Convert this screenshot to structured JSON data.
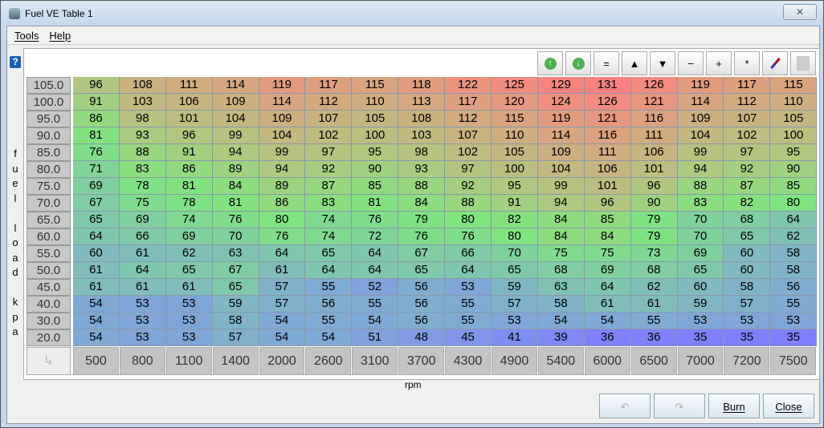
{
  "window": {
    "title": "Fuel VE Table 1",
    "close": "✕"
  },
  "menu": [
    "Tools",
    "Help"
  ],
  "help_icon": "?",
  "y_axis_label": "fuel load kpa",
  "x_axis_label": "rpm",
  "toolbar": [
    "up-circle",
    "down-circle",
    "=",
    "▲",
    "▼",
    "−",
    "+",
    "*",
    "pen",
    "square"
  ],
  "buttons": {
    "burn": "Burn",
    "close": "Close"
  },
  "table": {
    "y": [
      "105.0",
      "100.0",
      "95.0",
      "90.0",
      "85.0",
      "80.0",
      "75.0",
      "70.0",
      "65.0",
      "60.0",
      "55.0",
      "50.0",
      "45.0",
      "40.0",
      "30.0",
      "20.0"
    ],
    "x": [
      "500",
      "800",
      "1100",
      "1400",
      "2000",
      "2600",
      "3100",
      "3700",
      "4300",
      "4900",
      "5400",
      "6000",
      "6500",
      "7000",
      "7200",
      "7500"
    ],
    "values": [
      [
        96,
        108,
        111,
        114,
        119,
        117,
        115,
        118,
        122,
        125,
        129,
        131,
        126,
        119,
        117,
        115
      ],
      [
        91,
        103,
        106,
        109,
        114,
        112,
        110,
        113,
        117,
        120,
        124,
        126,
        121,
        114,
        112,
        110
      ],
      [
        86,
        98,
        101,
        104,
        109,
        107,
        105,
        108,
        112,
        115,
        119,
        121,
        116,
        109,
        107,
        105
      ],
      [
        81,
        93,
        96,
        99,
        104,
        102,
        100,
        103,
        107,
        110,
        114,
        116,
        111,
        104,
        102,
        100
      ],
      [
        76,
        88,
        91,
        94,
        99,
        97,
        95,
        98,
        102,
        105,
        109,
        111,
        106,
        99,
        97,
        95
      ],
      [
        71,
        83,
        86,
        89,
        94,
        92,
        90,
        93,
        97,
        100,
        104,
        106,
        101,
        94,
        92,
        90
      ],
      [
        69,
        78,
        81,
        84,
        89,
        87,
        85,
        88,
        92,
        95,
        99,
        101,
        96,
        88,
        87,
        85
      ],
      [
        67,
        75,
        78,
        81,
        86,
        83,
        81,
        84,
        88,
        91,
        94,
        96,
        90,
        83,
        82,
        80
      ],
      [
        65,
        69,
        74,
        76,
        80,
        74,
        76,
        79,
        80,
        82,
        84,
        85,
        79,
        70,
        68,
        64
      ],
      [
        64,
        66,
        69,
        70,
        76,
        74,
        72,
        76,
        76,
        80,
        84,
        84,
        79,
        70,
        65,
        62
      ],
      [
        60,
        61,
        62,
        63,
        64,
        65,
        64,
        67,
        66,
        70,
        75,
        75,
        73,
        69,
        60,
        58
      ],
      [
        61,
        64,
        65,
        67,
        61,
        64,
        64,
        65,
        64,
        65,
        68,
        69,
        68,
        65,
        60,
        58
      ],
      [
        61,
        61,
        61,
        65,
        57,
        55,
        52,
        56,
        53,
        59,
        63,
        64,
        62,
        60,
        58,
        56
      ],
      [
        54,
        53,
        53,
        59,
        57,
        56,
        55,
        56,
        55,
        57,
        58,
        61,
        61,
        59,
        57,
        55
      ],
      [
        54,
        53,
        53,
        58,
        54,
        55,
        54,
        56,
        55,
        53,
        54,
        54,
        55,
        53,
        53,
        53
      ],
      [
        54,
        53,
        53,
        57,
        54,
        54,
        51,
        48,
        45,
        41,
        39,
        36,
        36,
        35,
        35,
        35
      ]
    ]
  }
}
